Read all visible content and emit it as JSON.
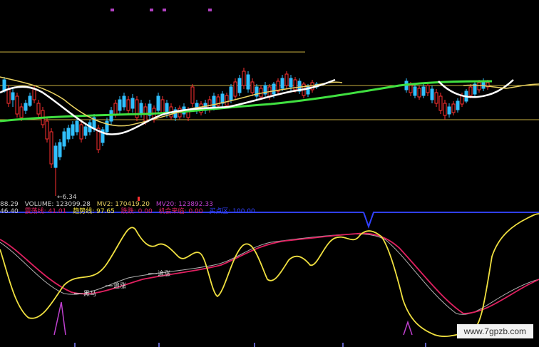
{
  "price_panel": {
    "low_marker": "←6.34"
  },
  "volume_row": {
    "left_value": "88.29",
    "volume_label": "VOLUME: 123099.28",
    "mv2_label": "MV2: 170419.20",
    "mv20_label": "MV20: 123892.33"
  },
  "indicator_row": {
    "left_value": "46.40",
    "item1": "震荡线: 41.01",
    "item2": "趋势线: 97.65",
    "item3": "跌跌: 0.00",
    "item4": "机会来临: 0.00",
    "item5": "买点区: 100.00"
  },
  "annotations": {
    "a1": "黑马",
    "a2": "追涨",
    "a3": "追涨"
  },
  "watermark": "www.7gpzb.com",
  "colors": {
    "up": "#ff3030",
    "down": "#30c0ff",
    "ma_white": "#ffffff",
    "ma_yellow": "#e8d060",
    "ma_green": "#40e040",
    "osc_yellow": "#f0e040",
    "osc_red": "#e02060",
    "osc_gray": "#b0b0b0",
    "signal_blue": "#3040ff",
    "spike_purple": "#c040d0"
  }
}
